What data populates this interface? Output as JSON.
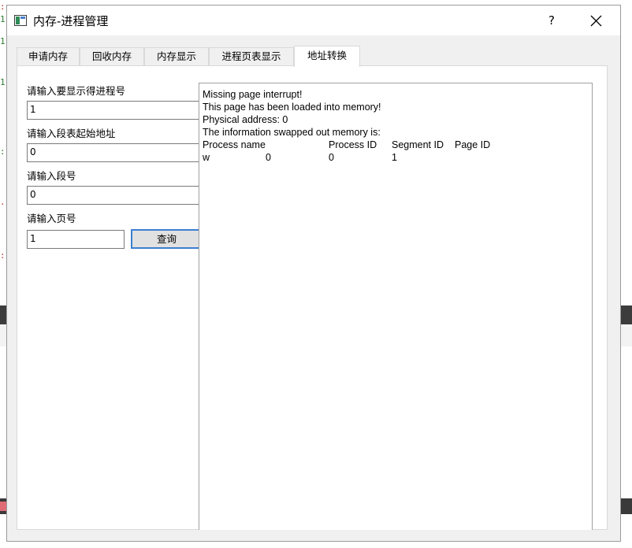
{
  "window": {
    "title": "内存-进程管理",
    "help_label": "?"
  },
  "tabs": [
    {
      "label": "申请内存",
      "active": false
    },
    {
      "label": "回收内存",
      "active": false
    },
    {
      "label": "内存显示",
      "active": false
    },
    {
      "label": "进程页表显示",
      "active": false
    },
    {
      "label": "地址转换",
      "active": true
    }
  ],
  "form": {
    "process_label": "请输入要显示得进程号",
    "process_value": "1",
    "segment_start_label": "请输入段表起始地址",
    "segment_start_value": "0",
    "segment_no_label": "请输入段号",
    "segment_no_value": "0",
    "page_no_label": "请输入页号",
    "page_no_value": "1",
    "query_label": "查询"
  },
  "output": {
    "lines": [
      "Missing page interrupt!",
      "This page has been loaded into memory!",
      "Physical address: 0",
      "The information swapped out memory is:"
    ],
    "headers": [
      "Process name",
      "Process ID",
      "Segment ID",
      "Page ID"
    ],
    "row": [
      "w",
      "0",
      "0",
      "1"
    ]
  },
  "colors": {
    "accent": "#3c7fd1",
    "window_bg": "#f0f0f0"
  }
}
